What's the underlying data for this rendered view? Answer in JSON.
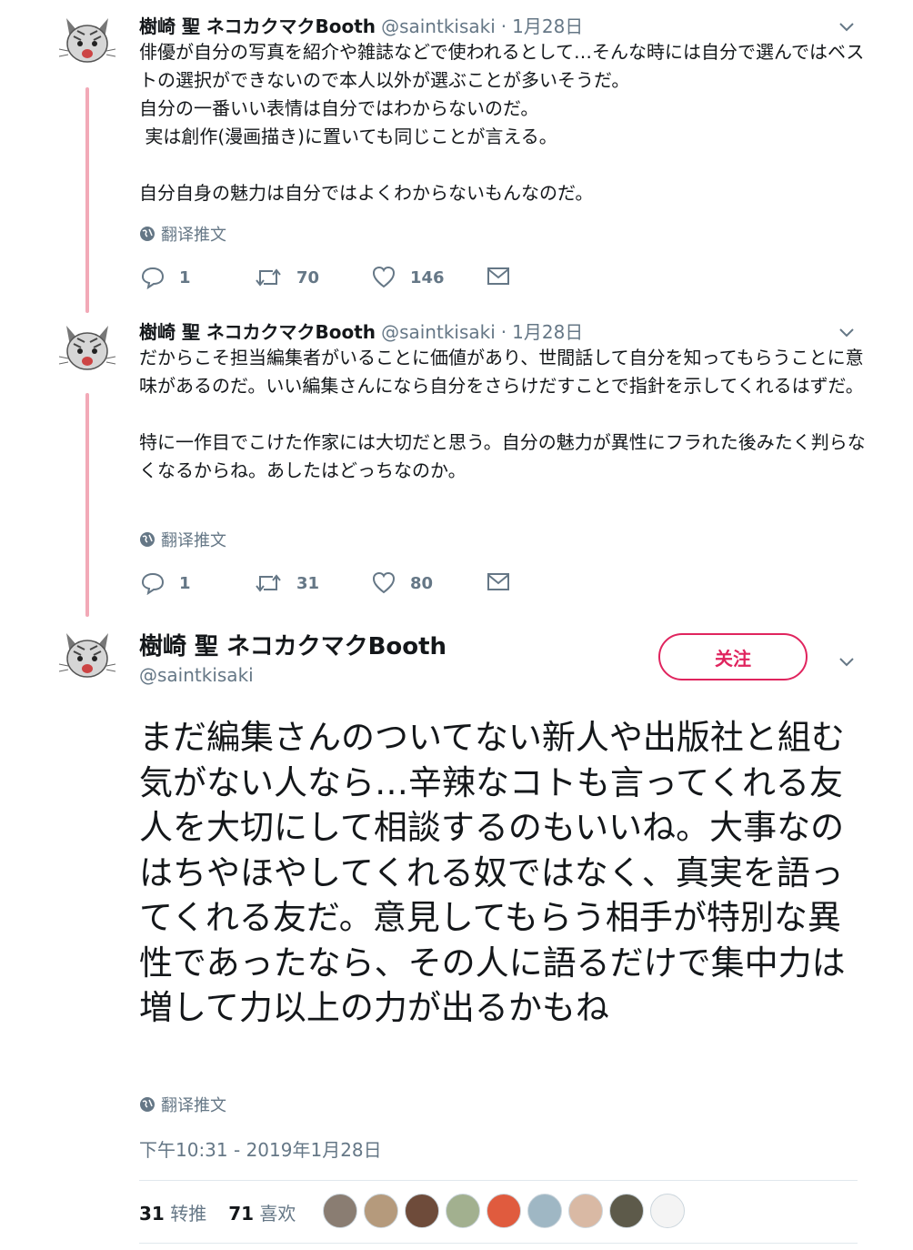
{
  "tweets": [
    {
      "display_name": "樹崎 聖 ネコカクマクBooth",
      "handle": "@saintkisaki",
      "separator": "·",
      "date": "1月28日",
      "text": "俳優が自分の写真を紹介や雑誌などで使われるとして…そんな時には自分で選んではベストの選択ができないので本人以外が選ぶことが多いそうだ。\n自分の一番いい表情は自分ではわからないのだ。\n 実は創作(漫画描き)に置いても同じことが言える。\n\n自分自身の魅力は自分ではよくわからないもんなのだ。",
      "translate_label": "翻译推文",
      "replies": "1",
      "retweets": "70",
      "likes": "146"
    },
    {
      "display_name": "樹崎 聖 ネコカクマクBooth",
      "handle": "@saintkisaki",
      "separator": "·",
      "date": "1月28日",
      "text": "だからこそ担当編集者がいることに価値があり、世間話して自分を知ってもらうことに意味があるのだ。いい編集さんになら自分をさらけだすことで指針を示してくれるはずだ。\n\n特に一作目でこけた作家には大切だと思う。自分の魅力が異性にフラれた後みたく判らなくなるからね。あしたはどっちなのか。",
      "translate_label": "翻译推文",
      "replies": "1",
      "retweets": "31",
      "likes": "80"
    }
  ],
  "main_tweet": {
    "display_name": "樹崎 聖 ネコカクマクBooth",
    "handle": "@saintkisaki",
    "follow_label": "关注",
    "text": "まだ編集さんのついてない新人や出版社と組む気がない人なら…辛辣なコトも言ってくれる友人を大切にして相談するのもいいね。大事なのはちやほやしてくれる奴ではなく、真実を語ってくれる友だ。意見してもらう相手が特別な異性であったなら、その人に語るだけで集中力は増して力以上の力が出るかもね",
    "translate_label": "翻译推文",
    "timestamp": "下午10:31 - 2019年1月28日",
    "retweet_count": "31",
    "retweet_label": "转推",
    "like_count": "71",
    "like_label": "喜欢",
    "liker_avatar_colors": [
      "#8a7d72",
      "#b59a7c",
      "#6e4b3a",
      "#a2b08f",
      "#e05b3e",
      "#9fb7c4",
      "#d9b9a4",
      "#5d5a4a",
      "#f4f4f4"
    ]
  },
  "colors": {
    "thread_line": "#f2a9b7",
    "accent_follow": "#e0245e",
    "muted_text": "#657786"
  },
  "icons": [
    "cat-avatar-icon",
    "chevron-down-icon",
    "globe-icon",
    "reply-icon",
    "retweet-icon",
    "like-icon",
    "message-icon"
  ]
}
